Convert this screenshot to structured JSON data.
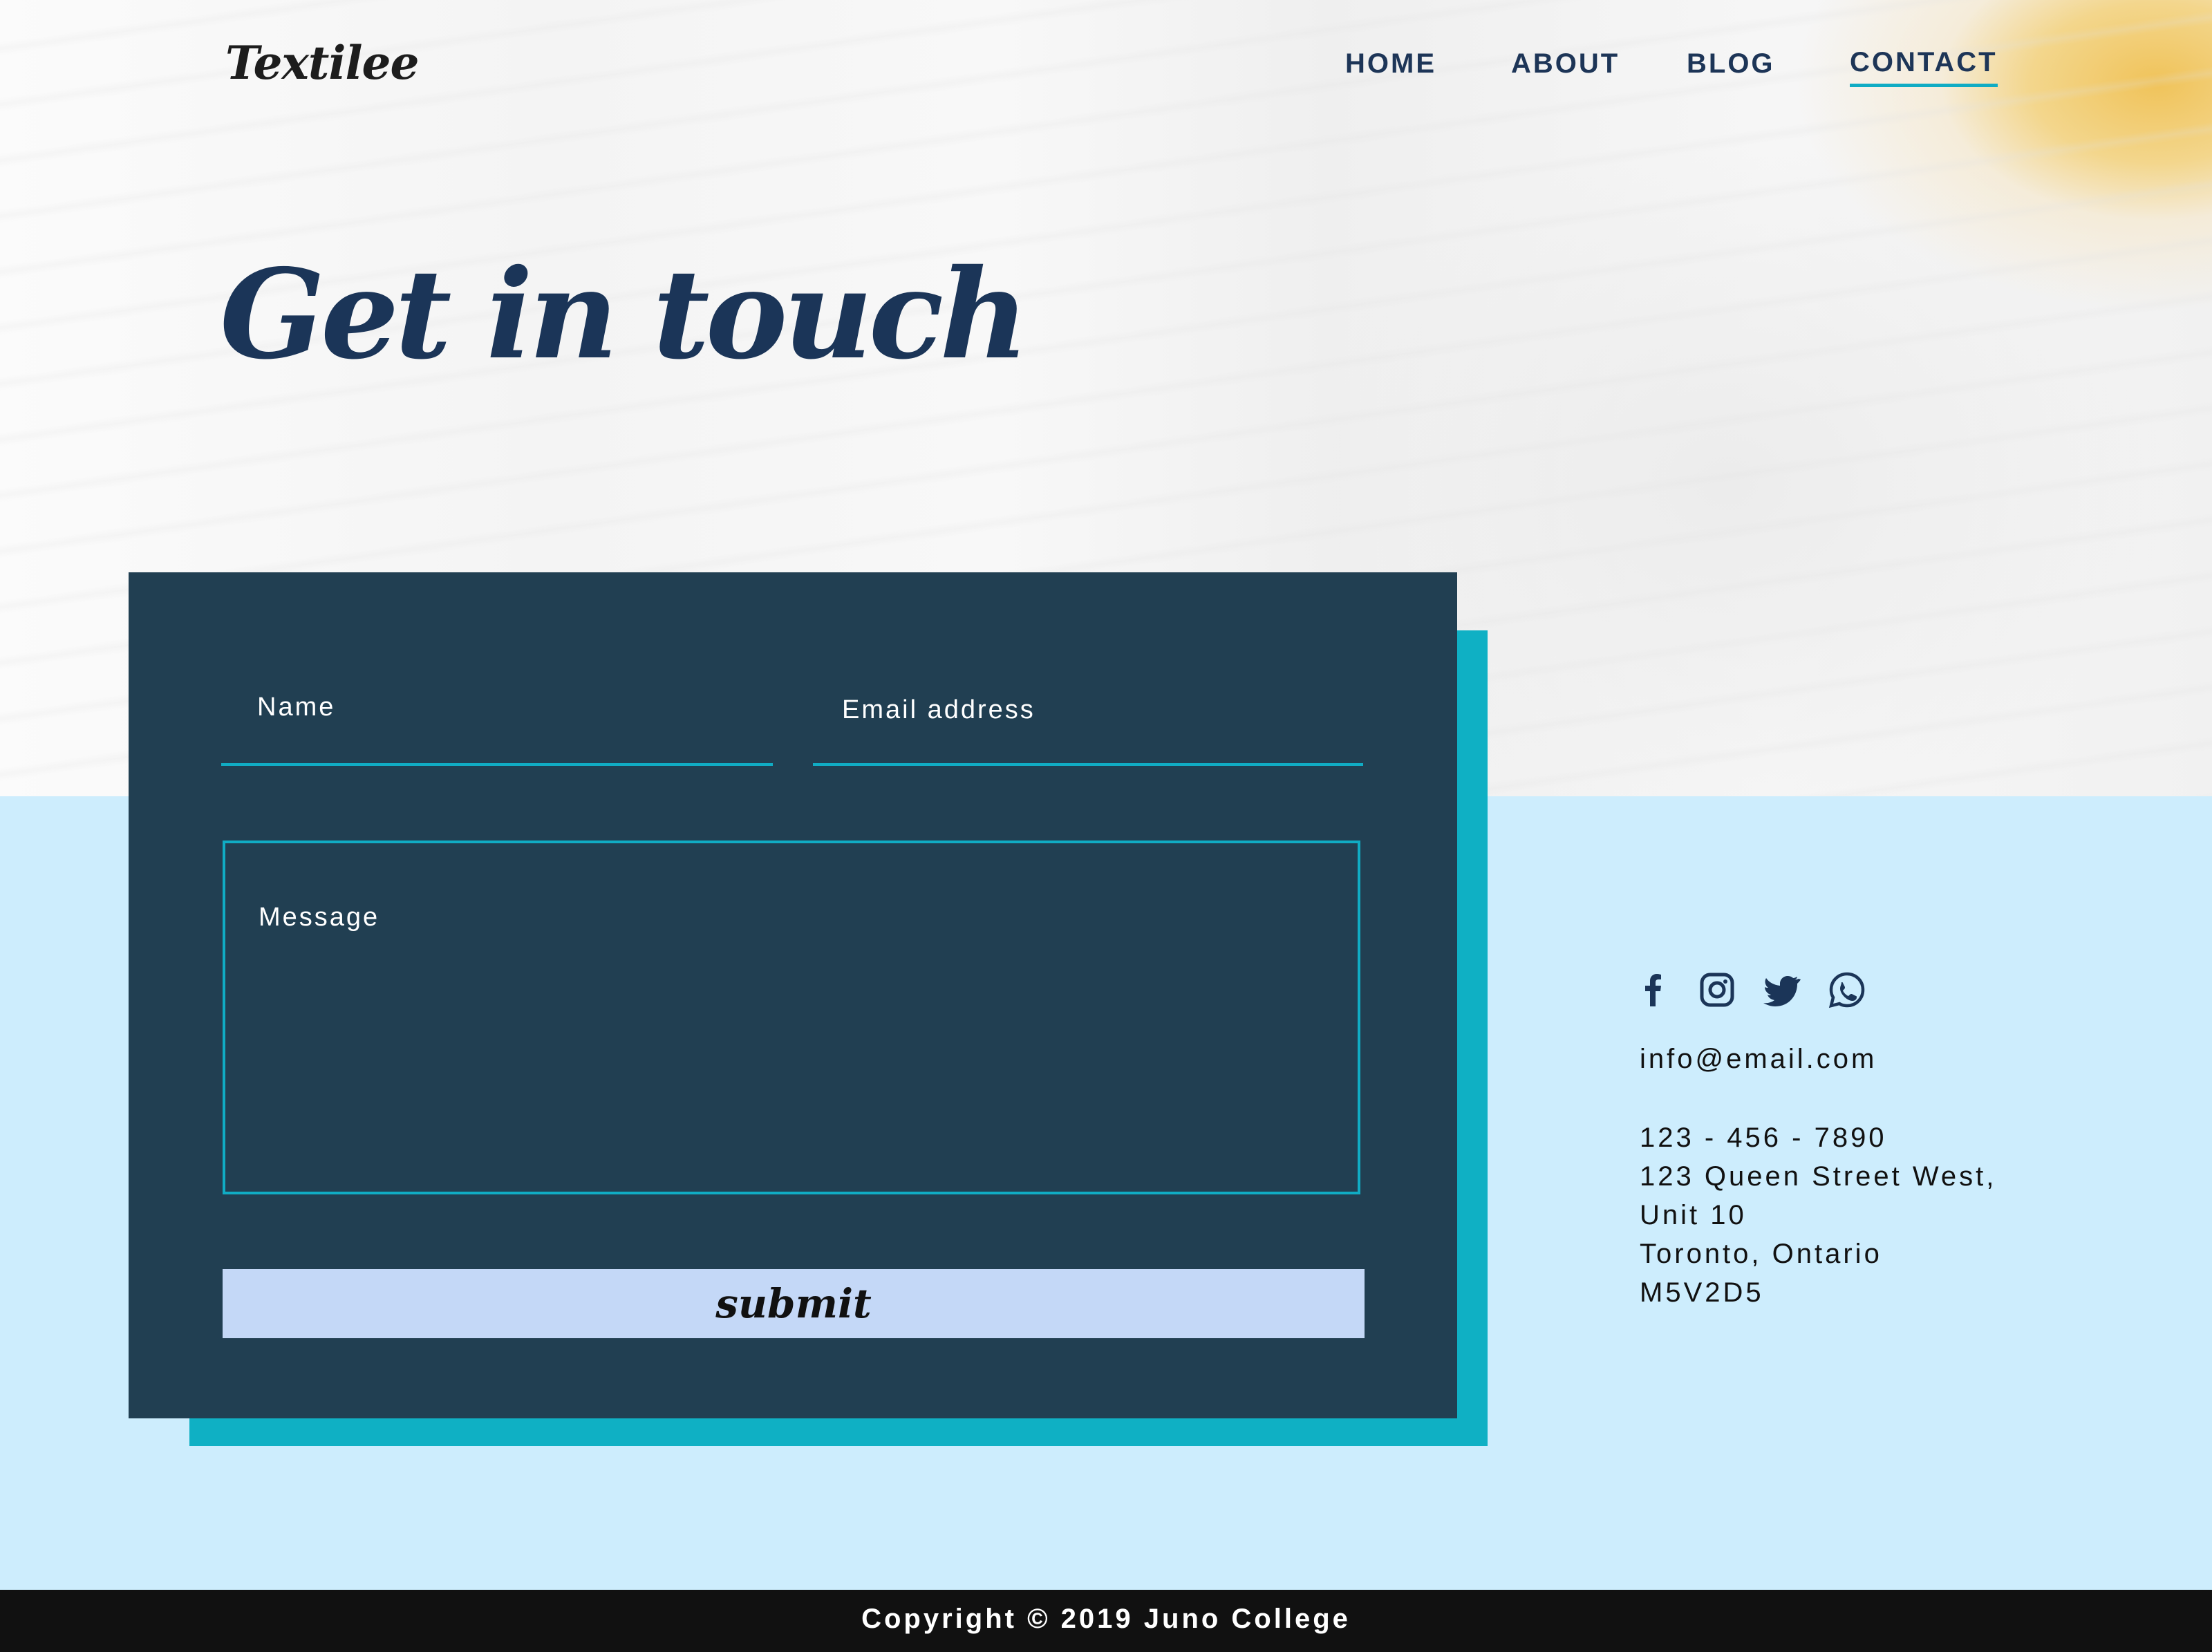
{
  "brand": {
    "logo": "Textilee"
  },
  "nav": {
    "items": [
      {
        "label": "HOME"
      },
      {
        "label": "ABOUT"
      },
      {
        "label": "BLOG"
      },
      {
        "label": "CONTACT",
        "active": true
      }
    ]
  },
  "hero": {
    "title": "Get in touch"
  },
  "form": {
    "name_placeholder": "Name",
    "email_placeholder": "Email address",
    "message_placeholder": "Message",
    "submit_label": "submit"
  },
  "contact": {
    "socials": [
      "facebook-icon",
      "instagram-icon",
      "twitter-icon",
      "whatsapp-icon"
    ],
    "email": "info@email.com",
    "phone": "123 - 456 - 7890",
    "address_line1": "123 Queen Street West,",
    "address_line2": "Unit 10",
    "address_line3": "Toronto, Ontario",
    "postal": "M5V2D5"
  },
  "footer": {
    "copyright": "Copyright © 2019 Juno College"
  },
  "colors": {
    "navy": "#1b3558",
    "card": "#213f52",
    "accent": "#0fb0c4",
    "light_blue": "#cdedfd",
    "submit_bg": "#c4d8f7",
    "footer_bg": "#111111"
  }
}
